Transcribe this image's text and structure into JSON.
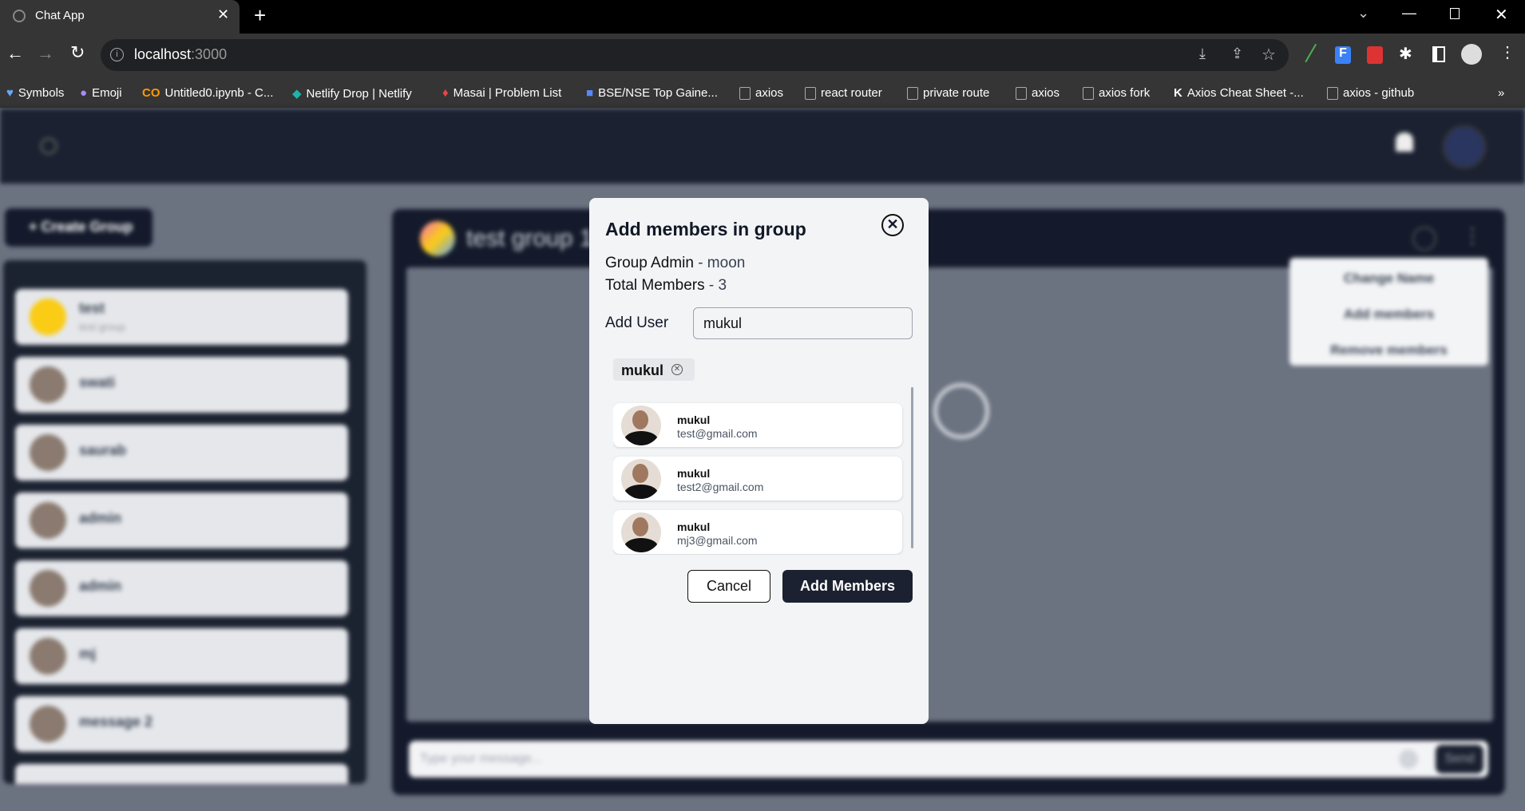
{
  "browser": {
    "tab_title": "Chat App",
    "url_host": "localhost",
    "url_port": ":3000",
    "bookmarks": [
      "Symbols",
      "Emoji",
      "Untitled0.ipynb - C...",
      "Netlify Drop | Netlify",
      "Masai | Problem List",
      "BSE/NSE Top Gaine...",
      "axios",
      "react router",
      "private route",
      "axios",
      "axios fork",
      "Axios Cheat Sheet -...",
      "axios - github"
    ],
    "more": "»"
  },
  "app": {
    "create_group": "+ Create Group",
    "chats": [
      {
        "name": "test",
        "sub": "test group"
      },
      {
        "name": "swati"
      },
      {
        "name": "saurab"
      },
      {
        "name": "admin"
      },
      {
        "name": "admin"
      },
      {
        "name": "mj"
      },
      {
        "name": "message 2"
      }
    ],
    "chat_title": "test group 1",
    "menu": [
      "Change Name",
      "Add members",
      "Remove members"
    ],
    "message_placeholder": "Type your message...",
    "send": "Send"
  },
  "modal": {
    "title": "Add members in group",
    "admin_label": "Group Admin",
    "admin_value": "- moon",
    "total_label": "Total Members",
    "total_value": "- 3",
    "add_user_label": "Add User",
    "add_user_value": "mukul",
    "chip": "mukul",
    "results": [
      {
        "name": "mukul",
        "email": "test@gmail.com"
      },
      {
        "name": "mukul",
        "email": "test2@gmail.com"
      },
      {
        "name": "mukul",
        "email": "mj3@gmail.com"
      }
    ],
    "cancel": "Cancel",
    "add": "Add Members"
  }
}
